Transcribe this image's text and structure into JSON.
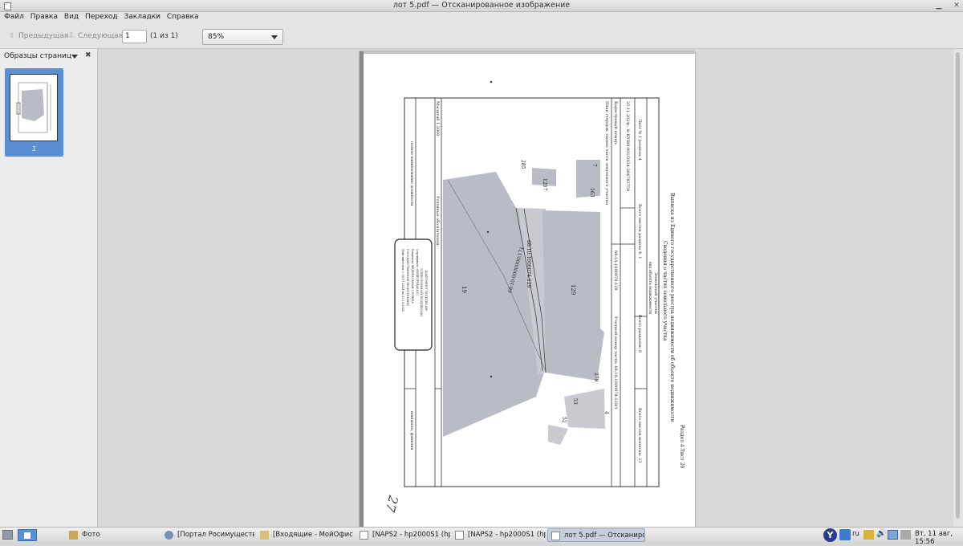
{
  "window": {
    "title": "лот 5.pdf — Отсканированное изображение"
  },
  "menu": {
    "items": [
      "Файл",
      "Правка",
      "Вид",
      "Переход",
      "Закладки",
      "Справка"
    ]
  },
  "toolbar": {
    "prev_label": "Предыдущая",
    "next_label": "Следующая",
    "page_value": "1",
    "page_count": "(1 из 1)",
    "zoom_value": "85%"
  },
  "sidebar": {
    "header": "Образцы страниц",
    "thumbnails": [
      {
        "label": "1"
      }
    ]
  },
  "document": {
    "header_title": "Выписка из Единого государственного реестра недвижимости об объекте недвижимости",
    "header_subtitle": "Сведения о частях земельного участка",
    "section_label": "Раздел 4",
    "sheet_label": "Лист 20",
    "object_type": "Земельный участок",
    "object_type_caption": "вид объекта недвижимости",
    "sheet_no": "Лист № 1 раздела 4",
    "total_sheets_section": "Всего листов раздела 4: 1",
    "total_sections": "Всего разделов: 8",
    "total_sheets": "Всего листов выписки: 23",
    "date_no": "25.11.2024г. № КУВИ-001/2024-284782754",
    "cadastral_number_label": "Кадастровый номер:",
    "cadastral_number": "68:10:1000074:129",
    "part_number": "Учетный номер части: 68:10:1000074:129/1",
    "plan_title": "План (чертеж, схема) части земельного участка",
    "scale": "Масштаб 1:2000",
    "legend": "Условные обозначения:",
    "position_caption": "полное наименование должности",
    "signature_caption": "инициалы, фамилия",
    "parcel_labels": [
      "129",
      "19",
      "1207",
      "163",
      "7",
      "285",
      "279",
      "53",
      "4",
      "52"
    ],
    "boundary_label": "68:10:1000074:129",
    "boundary_label_part": "68:10:0000000:171",
    "stamp_lines": [
      "ДОКУМЕНТ ПОДПИСАН",
      "ЭЛЕКТРОННОЙ ПОДПИСЬЮ",
      "Сертификат: 00B4E3F84A8A1C",
      "Владелец: ФЕДЕРАЛЬНАЯ СЛУЖБА",
      "ГОСУДАРСТВЕННОЙ РЕГИСТРАЦИИ",
      "Действителен: с 30.07.2024 по 22.10.2025"
    ],
    "handwritten": "27"
  },
  "taskbar": {
    "tasks": [
      {
        "label": "Фото"
      },
      {
        "label": "[Портал Росимущества ..."
      },
      {
        "label": "[Входящие - МойОфис П..."
      },
      {
        "label": "[NAPS2 - hp2000S1 (hp200..."
      },
      {
        "label": "[NAPS2 - hp2000S1 (hp200..."
      },
      {
        "label": "лот 5.pdf — Отсканирова..."
      }
    ],
    "lang": "ru",
    "clock": "Вт, 11 авг, 15:56"
  },
  "colors": {
    "selection": "#5b8fd1",
    "map_fill": "#b9bcc2",
    "page_bg": "#ffffff"
  }
}
